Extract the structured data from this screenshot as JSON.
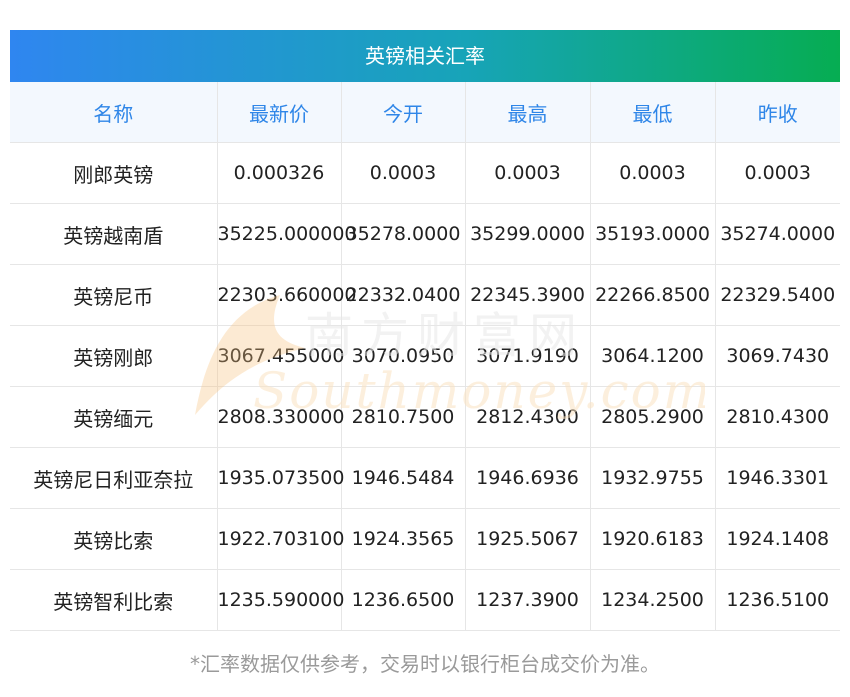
{
  "title": "英镑相关汇率",
  "columns": [
    "名称",
    "最新价",
    "今开",
    "最高",
    "最低",
    "昨收"
  ],
  "rows": [
    [
      "刚郎英镑",
      "0.000326",
      "0.0003",
      "0.0003",
      "0.0003",
      "0.0003"
    ],
    [
      "英镑越南盾",
      "35225.000000",
      "35278.0000",
      "35299.0000",
      "35193.0000",
      "35274.0000"
    ],
    [
      "英镑尼币",
      "22303.660000",
      "22332.0400",
      "22345.3900",
      "22266.8500",
      "22329.5400"
    ],
    [
      "英镑刚郎",
      "3067.455000",
      "3070.0950",
      "3071.9190",
      "3064.1200",
      "3069.7430"
    ],
    [
      "英镑缅元",
      "2808.330000",
      "2810.7500",
      "2812.4300",
      "2805.2900",
      "2810.4300"
    ],
    [
      "英镑尼日利亚奈拉",
      "1935.073500",
      "1946.5484",
      "1946.6936",
      "1932.9755",
      "1946.3301"
    ],
    [
      "英镑比索",
      "1922.703100",
      "1924.3565",
      "1925.5067",
      "1920.6183",
      "1924.1408"
    ],
    [
      "英镑智利比索",
      "1235.590000",
      "1236.6500",
      "1237.3900",
      "1234.2500",
      "1236.5100"
    ]
  ],
  "footnote": "*汇率数据仅供参考，交易时以银行柜台成交价为准。",
  "watermark": {
    "cn": "南方财富网",
    "en": "Southmoney.com"
  },
  "colors": {
    "header_text": "#2f86e8",
    "header_bg": "#f3f8fe",
    "title_start": "#2f86f0",
    "title_end": "#06ad52"
  }
}
